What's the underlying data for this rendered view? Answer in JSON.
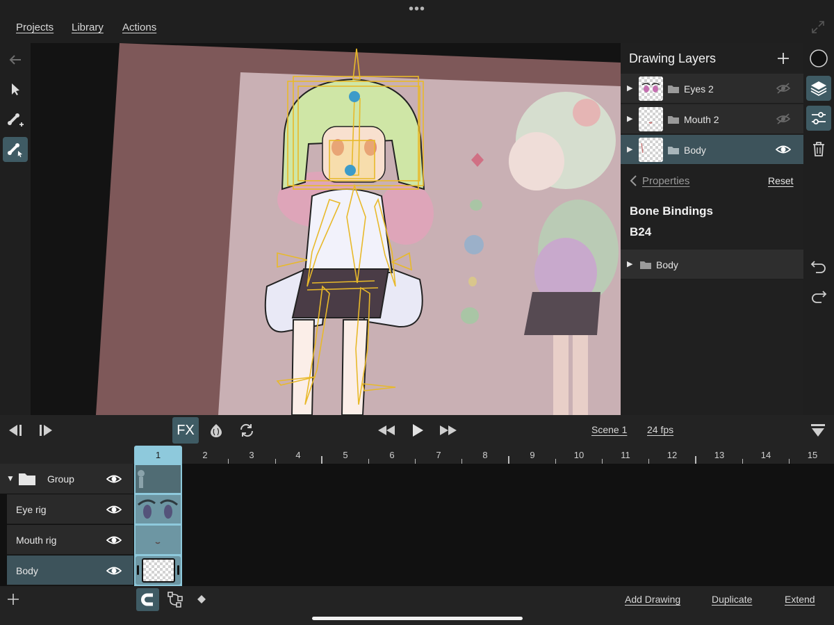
{
  "top_menu": {
    "projects": "Projects",
    "library": "Library",
    "actions": "Actions"
  },
  "layers_panel": {
    "title": "Drawing Layers",
    "layers": [
      {
        "name": "Eyes 2",
        "visible": false
      },
      {
        "name": "Mouth 2",
        "visible": false
      },
      {
        "name": "Body",
        "visible": true,
        "selected": true
      }
    ],
    "properties_back": "Properties",
    "reset": "Reset",
    "bindings_title": "Bone Bindings",
    "bone_name": "B24",
    "binding_item": "Body"
  },
  "transport": {
    "fx": "FX",
    "scene": "Scene 1",
    "fps": "24 fps"
  },
  "timeline": {
    "current_frame": "1",
    "frames": [
      "2",
      "3",
      "4",
      "5",
      "6",
      "7",
      "8",
      "9",
      "10",
      "11",
      "12",
      "13",
      "14",
      "15"
    ],
    "tracks": [
      {
        "name": "Group",
        "type": "group"
      },
      {
        "name": "Eye rig"
      },
      {
        "name": "Mouth rig"
      },
      {
        "name": "Body",
        "selected": true
      }
    ]
  },
  "bottom_bar": {
    "add_drawing": "Add Drawing",
    "duplicate": "Duplicate",
    "extend": "Extend"
  },
  "colors": {
    "accent": "#3f5b64",
    "frame_highlight": "#8ec9dc",
    "bone": "#e8b92a"
  }
}
